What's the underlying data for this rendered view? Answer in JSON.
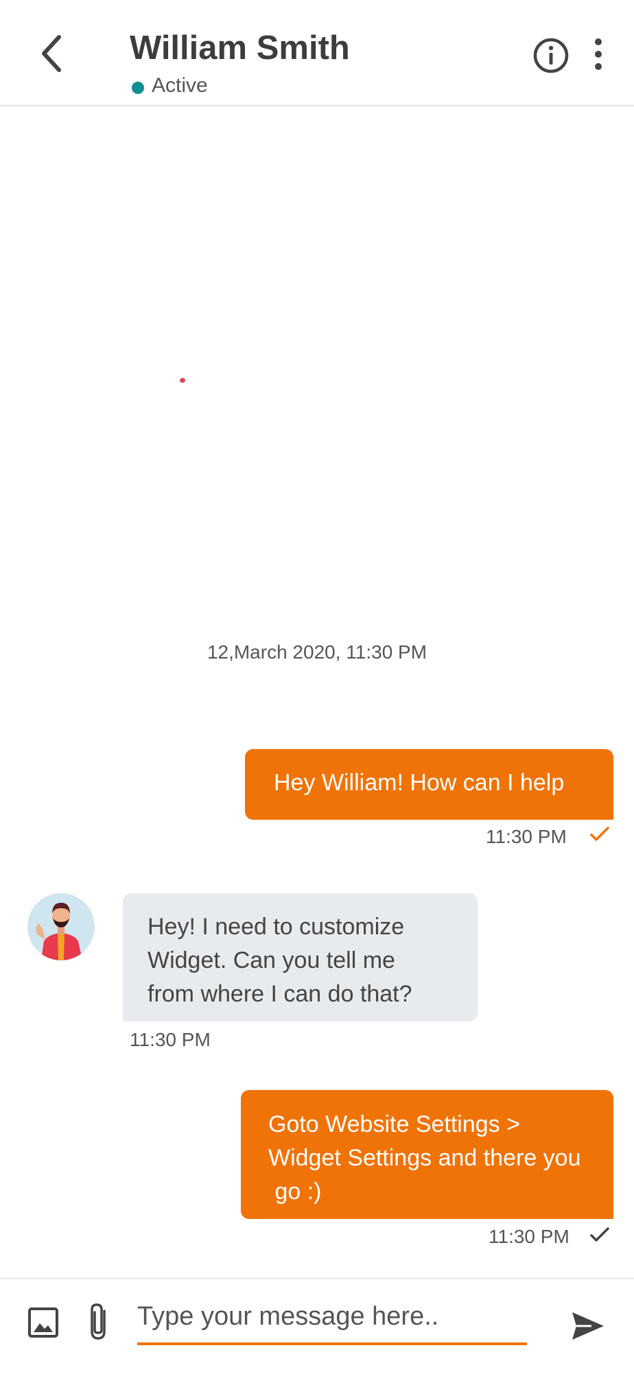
{
  "header": {
    "name": "William Smith",
    "status": "Active"
  },
  "conversation": {
    "date": "12,March 2020, 11:30 PM",
    "messages": [
      {
        "direction": "outgoing",
        "lines": [
          "Hey William! How can I help"
        ],
        "time": "11:30 PM",
        "read": true
      },
      {
        "direction": "incoming",
        "lines": [
          "Hey! I need to customize",
          "Widget. Can you tell me",
          "from where I can do that?"
        ],
        "time": "11:30 PM"
      },
      {
        "direction": "outgoing",
        "lines": [
          "Goto Website Settings >",
          "Widget Settings and there you",
          " go :)"
        ],
        "time": "11:30 PM",
        "read": false
      }
    ]
  },
  "composer": {
    "placeholder": "Type your message here.."
  },
  "colors": {
    "accent": "#f07308",
    "active": "#0f8f8f",
    "incoming_bubble": "#e8ebee"
  },
  "icons": [
    "back-arrow-icon",
    "info-icon",
    "more-vertical-icon",
    "check-icon",
    "image-icon",
    "paperclip-icon",
    "send-icon"
  ]
}
